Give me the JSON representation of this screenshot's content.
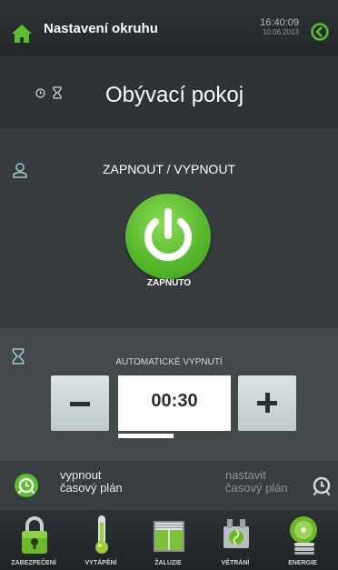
{
  "header": {
    "title": "Nastavení okruhu",
    "time": "16:40:09",
    "date": "10.06.2013"
  },
  "room": {
    "name": "Obývací pokoj"
  },
  "power": {
    "label": "ZAPNOUT / VYPNOUT",
    "state": "ZAPNUTO"
  },
  "timer": {
    "label": "AUTOMATICKÉ VYPNUTÍ",
    "value": "00:30"
  },
  "plan": {
    "left_line1": "vypnout",
    "left_line2": "časový plán",
    "right_line1": "nastavit",
    "right_line2": "časový plán"
  },
  "nav": {
    "items": [
      {
        "label": "ZABEZPEČENÍ",
        "icon": "padlock-icon"
      },
      {
        "label": "VYTÁPĚNÍ",
        "icon": "thermometer-icon"
      },
      {
        "label": "ŽALUZIE",
        "icon": "blinds-icon"
      },
      {
        "label": "VĚTRÁNÍ",
        "icon": "fan-icon"
      },
      {
        "label": "ENERGIE",
        "icon": "energy-icon"
      }
    ]
  },
  "colors": {
    "accent_green": "#5cbf2f",
    "background": "#2f3436",
    "button_gray": "#cbd5d8"
  }
}
